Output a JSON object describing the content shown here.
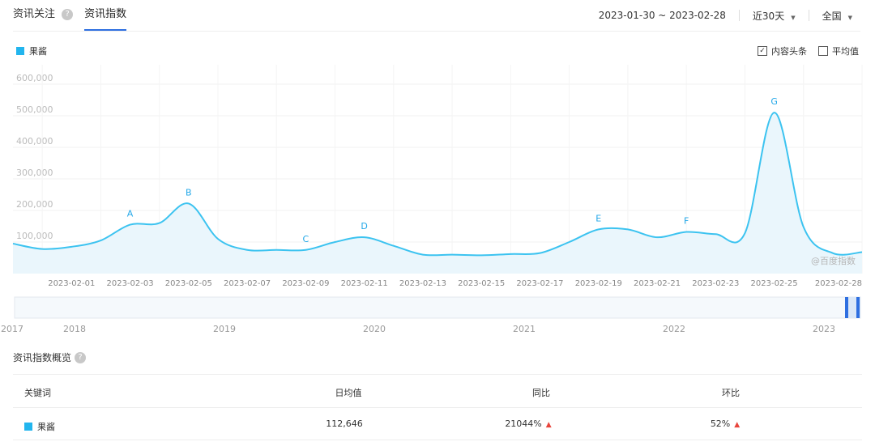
{
  "tabs": [
    {
      "label": "资讯关注",
      "active": false,
      "help_icon": "?"
    },
    {
      "label": "资讯指数",
      "active": true
    }
  ],
  "controls": {
    "date_range": "2023-01-30 ~ 2023-02-28",
    "period": "近30天",
    "region": "全国"
  },
  "legend": {
    "label": "果酱",
    "color": "#22b5ee"
  },
  "options": [
    {
      "label": "内容头条",
      "checked": true
    },
    {
      "label": "平均值",
      "checked": false
    }
  ],
  "watermark": "@百度指数",
  "chart_data": {
    "type": "area",
    "series_color": "#3cc3f0",
    "fill_color": "#eaf6fc",
    "y_ticks": [
      "100,000",
      "200,000",
      "300,000",
      "400,000",
      "500,000",
      "600,000"
    ],
    "ylim": [
      0,
      640000
    ],
    "x_tick_labels": [
      "2023-02-01",
      "2023-02-03",
      "2023-02-05",
      "2023-02-07",
      "2023-02-09",
      "2023-02-11",
      "2023-02-13",
      "2023-02-15",
      "2023-02-17",
      "2023-02-19",
      "2023-02-21",
      "2023-02-23",
      "2023-02-25",
      "2023-02-28"
    ],
    "x": [
      "2023-01-30",
      "2023-01-31",
      "2023-02-01",
      "2023-02-02",
      "2023-02-03",
      "2023-02-04",
      "2023-02-05",
      "2023-02-06",
      "2023-02-07",
      "2023-02-08",
      "2023-02-09",
      "2023-02-10",
      "2023-02-11",
      "2023-02-12",
      "2023-02-13",
      "2023-02-14",
      "2023-02-15",
      "2023-02-16",
      "2023-02-17",
      "2023-02-18",
      "2023-02-19",
      "2023-02-20",
      "2023-02-21",
      "2023-02-22",
      "2023-02-23",
      "2023-02-24",
      "2023-02-25",
      "2023-02-26",
      "2023-02-27",
      "2023-02-28"
    ],
    "values": [
      95000,
      78000,
      85000,
      105000,
      155000,
      160000,
      222000,
      110000,
      75000,
      75000,
      75000,
      100000,
      115000,
      88000,
      60000,
      60000,
      58000,
      62000,
      65000,
      100000,
      140000,
      140000,
      115000,
      132000,
      125000,
      128000,
      510000,
      148000,
      65000,
      68000
    ],
    "annotations": [
      {
        "label": "A",
        "index": 4
      },
      {
        "label": "B",
        "index": 6
      },
      {
        "label": "C",
        "index": 10
      },
      {
        "label": "D",
        "index": 12
      },
      {
        "label": "E",
        "index": 20
      },
      {
        "label": "F",
        "index": 23
      },
      {
        "label": "G",
        "index": 26
      }
    ],
    "grid": true,
    "navigator_years": [
      "2017",
      "2018",
      "2019",
      "2020",
      "2021",
      "2022",
      "2023"
    ]
  },
  "overview": {
    "title": "资讯指数概览",
    "columns": [
      "关键词",
      "日均值",
      "同比",
      "环比"
    ],
    "rows": [
      {
        "keyword": "果酱",
        "avg": "112,646",
        "yoy": "21044%",
        "mom": "52%"
      }
    ]
  }
}
